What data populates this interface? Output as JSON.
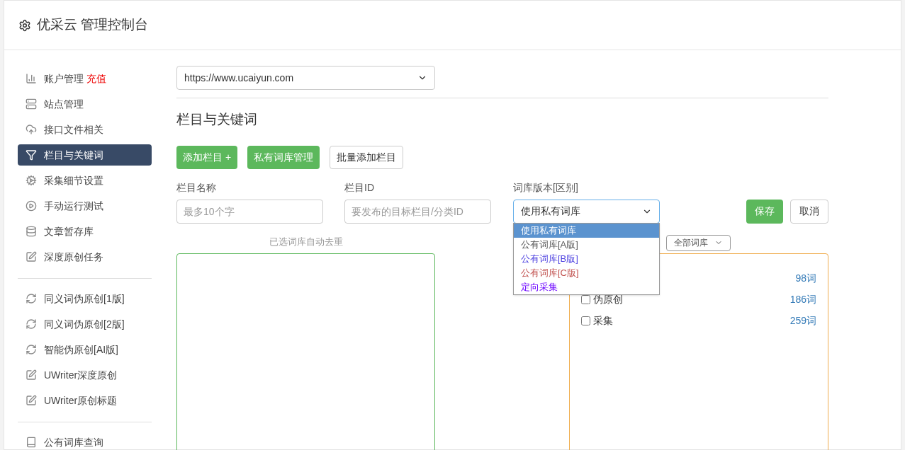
{
  "header": {
    "title": "优采云 管理控制台"
  },
  "sidebar": {
    "groups": [
      {
        "items": [
          {
            "label": "账户管理",
            "badge": "充值",
            "kind": "chart",
            "selected": false
          },
          {
            "label": "站点管理",
            "kind": "server",
            "selected": false
          },
          {
            "label": "接口文件相关",
            "kind": "cloud",
            "selected": false
          },
          {
            "label": "栏目与关键词",
            "kind": "filter",
            "selected": true
          },
          {
            "label": "采集细节设置",
            "kind": "gears",
            "selected": false
          },
          {
            "label": "手动运行测试",
            "kind": "play",
            "selected": false
          },
          {
            "label": "文章暂存库",
            "kind": "database",
            "selected": false
          },
          {
            "label": "深度原创任务",
            "kind": "edit",
            "selected": false
          }
        ]
      },
      {
        "items": [
          {
            "label": "同义词伪原创[1版]",
            "kind": "refresh",
            "selected": false
          },
          {
            "label": "同义词伪原创[2版]",
            "kind": "refresh",
            "selected": false
          },
          {
            "label": "智能伪原创[AI版]",
            "kind": "refresh",
            "selected": false
          },
          {
            "label": "UWriter深度原创",
            "kind": "edit",
            "selected": false
          },
          {
            "label": "UWriter原创标题",
            "kind": "edit",
            "selected": false
          }
        ]
      },
      {
        "items": [
          {
            "label": "公有词库查询",
            "kind": "book",
            "selected": false
          }
        ]
      }
    ]
  },
  "site_select": {
    "value": "https://www.ucaiyun.com"
  },
  "section_title": "栏目与关键词",
  "buttons": [
    {
      "label": "添加栏目 +",
      "kind": "primary"
    },
    {
      "label": "私有词库管理",
      "kind": "primary"
    },
    {
      "label": "批量添加栏目",
      "kind": "default"
    }
  ],
  "form": {
    "name": {
      "label": "栏目名称",
      "placeholder": "最多10个字"
    },
    "id": {
      "label": "栏目ID",
      "placeholder": "要发布的目标栏目/分类ID"
    },
    "version": {
      "label": "词库版本[区别]",
      "value": "使用私有词库",
      "expanded": true,
      "options": [
        {
          "label": "使用私有词库",
          "selected": true
        },
        {
          "label": "公有词库[A版]",
          "selected": false,
          "color": "#555555"
        },
        {
          "label": "公有词库[B版]",
          "selected": false,
          "color": "#4b3fe0"
        },
        {
          "label": "公有词库[C版]",
          "selected": false,
          "color": "#c0504d"
        },
        {
          "label": "定向采集",
          "selected": false,
          "color": "#6a00ff"
        }
      ]
    },
    "save": "保存",
    "cancel": "取消"
  },
  "selected_note": "已选词库自动去重",
  "library_filter": "全部词库",
  "libraries": [
    {
      "count": "98词"
    },
    {
      "label": "伪原创",
      "count": "186词",
      "checked": false
    },
    {
      "label": "采集",
      "count": "259词",
      "checked": false
    }
  ]
}
